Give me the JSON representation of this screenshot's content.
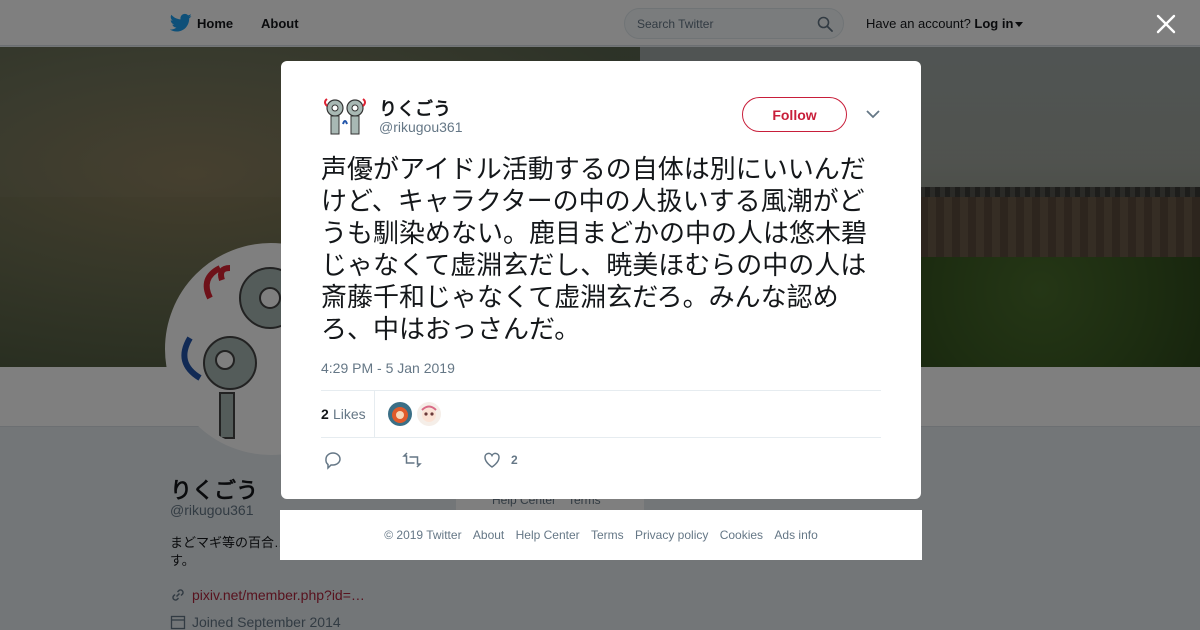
{
  "header": {
    "home_label": "Home",
    "about_label": "About",
    "search_placeholder": "Search Twitter",
    "have_account": "Have an account?",
    "login_label": "Log in",
    "brand_color": "#1da1f2"
  },
  "profile": {
    "name": "りくごう",
    "handle": "@rikugou361",
    "bio": "まどマギ等の百合…ガエル飼いで趣味は囲碁です。",
    "link": "pixiv.net/member.php?id=…",
    "joined": "Joined September 2014",
    "sidebar_footer": [
      "Help Center",
      "Terms"
    ]
  },
  "tweet": {
    "name": "りくごう",
    "handle": "@rikugou361",
    "follow_label": "Follow",
    "text": "声優がアイドル活動するの自体は別にいいんだけど、キャラクターの中の人扱いする風潮がどうも馴染めない。鹿目まどかの中の人は悠木碧じゃなくて虚淵玄だし、暁美ほむらの中の人は斎藤千和じゃなくて虚淵玄だろ。みんな認めろ、中はおっさんだ。",
    "timestamp": "4:29 PM - 5 Jan 2019",
    "likes_count": "2",
    "likes_label": "Likes",
    "like_action_count": "2",
    "accent_color": "#c81e3a"
  },
  "footer": {
    "copyright": "© 2019 Twitter",
    "links": [
      "About",
      "Help Center",
      "Terms",
      "Privacy policy",
      "Cookies",
      "Ads info"
    ]
  }
}
